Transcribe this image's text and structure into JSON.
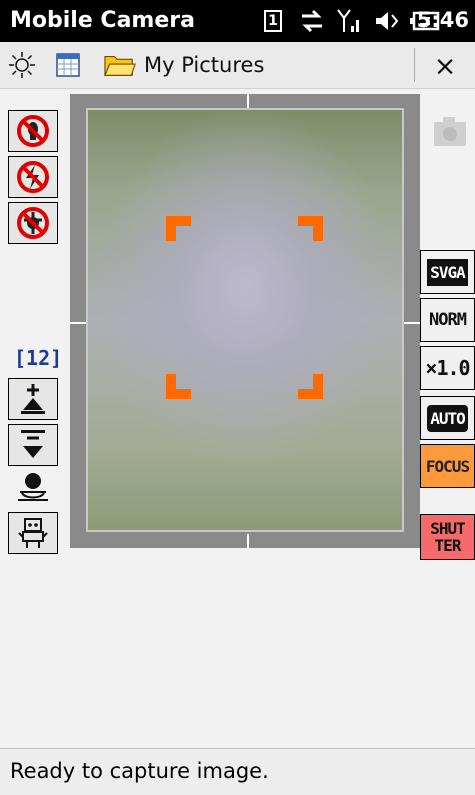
{
  "status_bar": {
    "app_title": "Mobile Camera",
    "sim_badge": "1",
    "time": "5:46"
  },
  "menu_bar": {
    "folder_label": "My Pictures",
    "close_label": "×"
  },
  "left_panel": {
    "counter": "[12]"
  },
  "right_panel": {
    "resolution_label": "SVGA",
    "quality_label": "NORM",
    "zoom_label": "×1.0",
    "mode_label": "AUTO",
    "focus_label": "FOCUS",
    "shutter_line1": "SHUT",
    "shutter_line2": "TER"
  },
  "status_line": {
    "message": "Ready to capture image."
  },
  "colors": {
    "focus_bracket": "#ff6a00",
    "focus_button": "#ff9a3c",
    "shutter_button": "#f76a6a",
    "counter_text": "#1b3d99"
  }
}
